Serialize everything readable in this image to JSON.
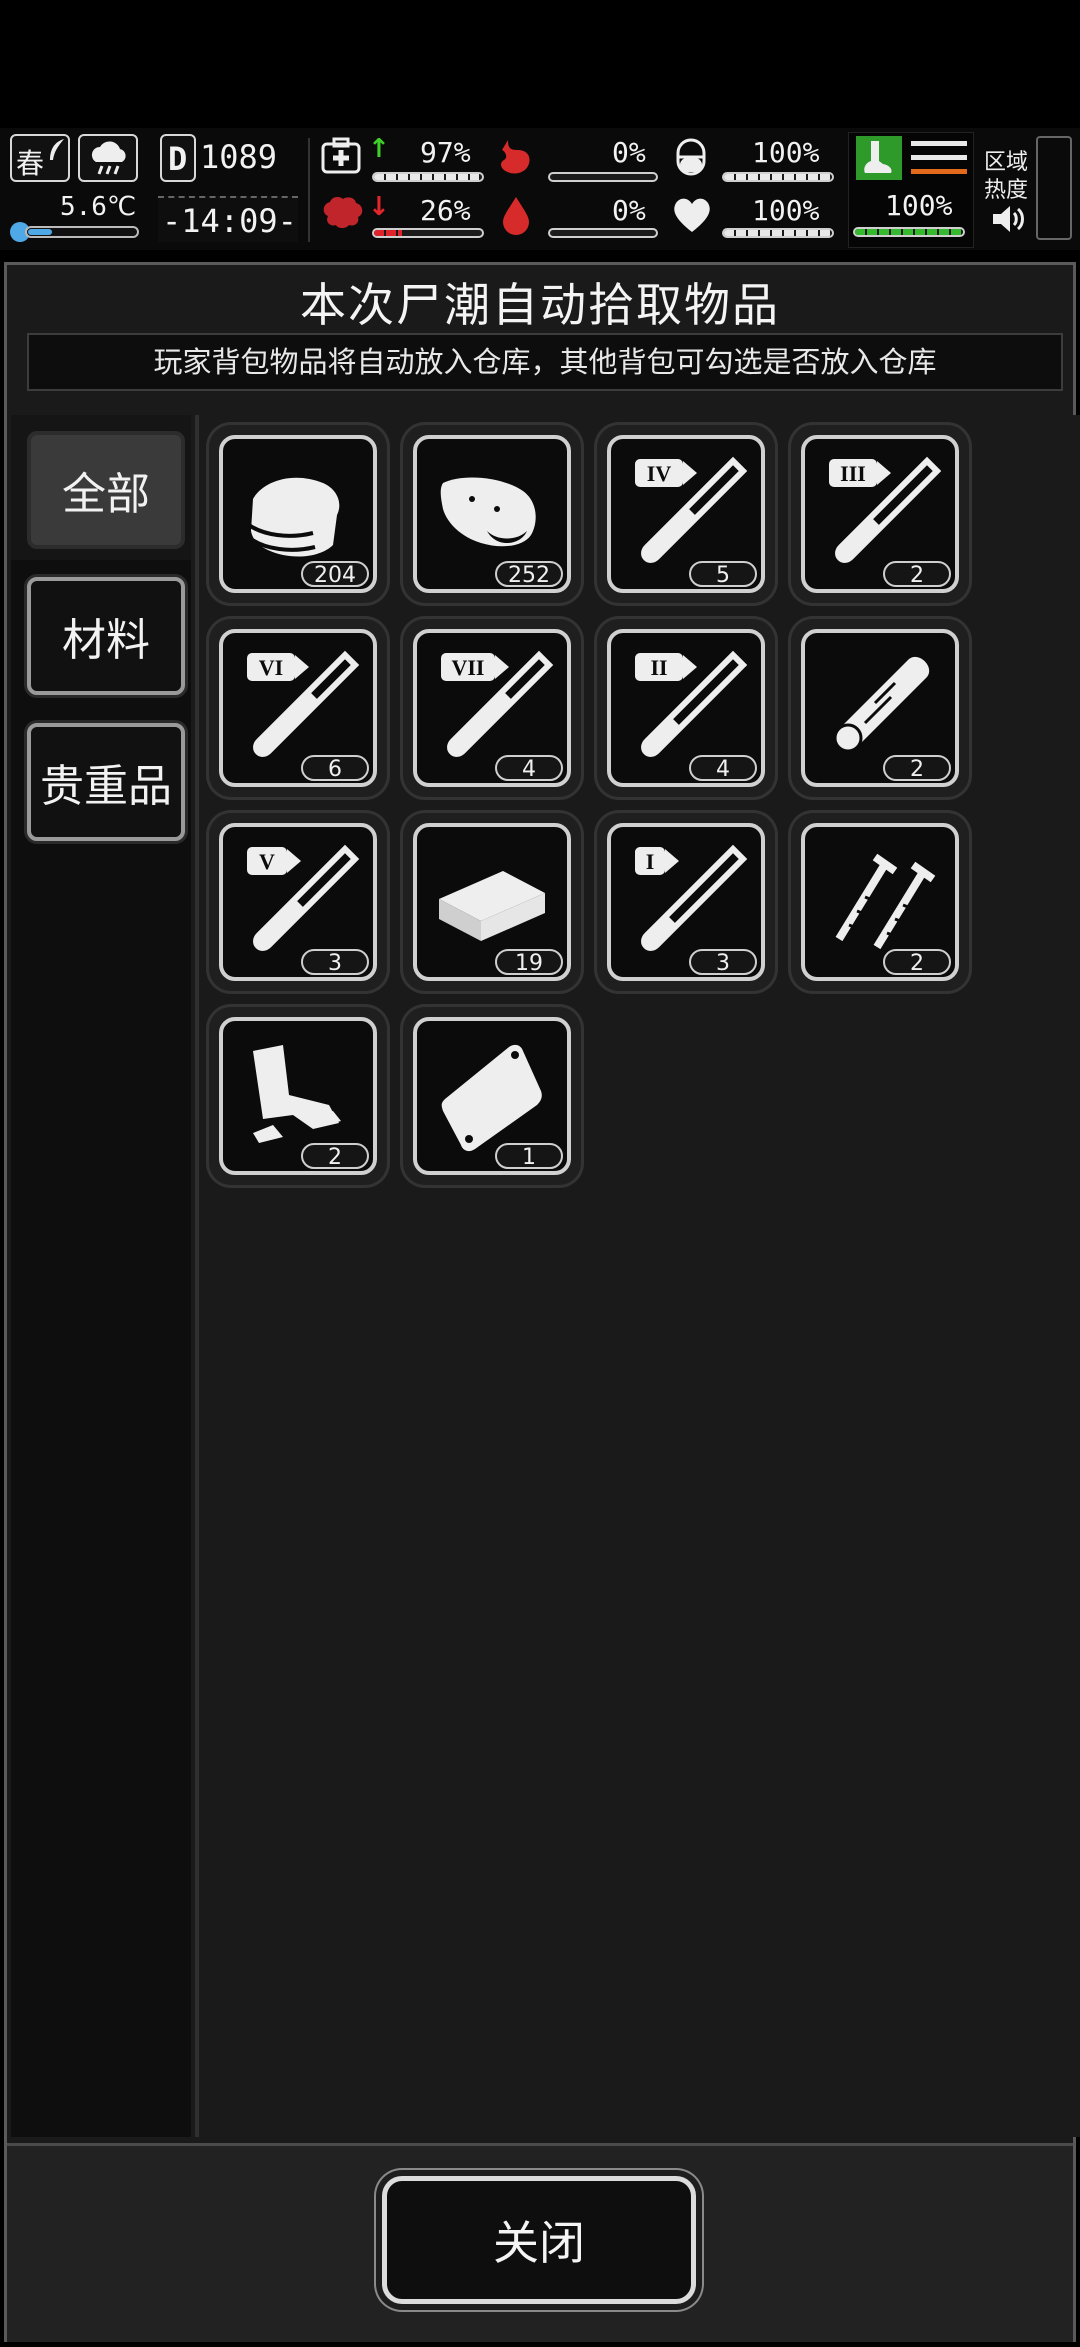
{
  "hud": {
    "season": "春",
    "temperature": "5.6℃",
    "day_prefix": "D",
    "day": "1089",
    "time": "-14:09-",
    "health_pct": "97%",
    "hunger_pct": "0%",
    "stamina_pct": "100%",
    "mental_pct": "26%",
    "thirst_pct": "0%",
    "heart_pct": "100%",
    "foot_pct": "100%",
    "zone_heat_label_1": "区域",
    "zone_heat_label_2": "热度",
    "levels": {
      "health": 0.97,
      "hunger": 0,
      "stamina": 1.0,
      "mental": 0.26,
      "thirst": 0,
      "heart": 1.0,
      "foot": 1.0
    }
  },
  "panel": {
    "title": "本次尸潮自动拾取物品",
    "subtitle": "玩家背包物品将自动放入仓库，其他背包可勾选是否放入仓库"
  },
  "tabs": [
    {
      "label": "全部",
      "active": true
    },
    {
      "label": "材料",
      "active": false
    },
    {
      "label": "贵重品",
      "active": false
    }
  ],
  "items": [
    {
      "icon": "cloth-icon",
      "count": "204"
    },
    {
      "icon": "meat-icon",
      "count": "252"
    },
    {
      "icon": "test-tube-IV-icon",
      "tier": "IV",
      "count": "5"
    },
    {
      "icon": "test-tube-III-icon",
      "tier": "III",
      "count": "2"
    },
    {
      "icon": "test-tube-VI-icon",
      "tier": "VI",
      "count": "6"
    },
    {
      "icon": "test-tube-VII-icon",
      "tier": "VII",
      "count": "4"
    },
    {
      "icon": "test-tube-II-icon",
      "tier": "II",
      "count": "4"
    },
    {
      "icon": "log-icon",
      "count": "2"
    },
    {
      "icon": "test-tube-V-icon",
      "tier": "V",
      "count": "3"
    },
    {
      "icon": "brick-icon",
      "count": "19"
    },
    {
      "icon": "test-tube-I-icon",
      "tier": "I",
      "count": "3"
    },
    {
      "icon": "screws-icon",
      "count": "2"
    },
    {
      "icon": "scrap-metal-icon",
      "count": "2"
    },
    {
      "icon": "plastic-bag-icon",
      "count": "1"
    }
  ],
  "footer": {
    "close_label": "关闭"
  },
  "colors": {
    "accent_green": "#35b92f",
    "accent_red": "#e0232b",
    "background": "#1a1a1a"
  }
}
